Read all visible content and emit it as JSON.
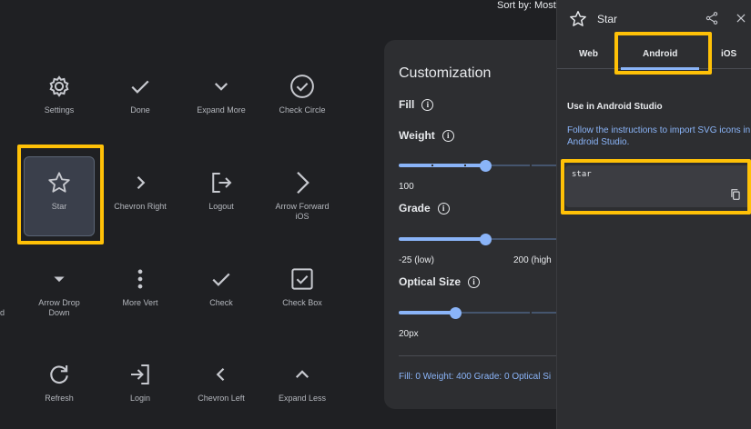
{
  "header": {
    "sort_label": "Sort by: Most"
  },
  "icons": [
    {
      "label": "Settings"
    },
    {
      "label": "Done"
    },
    {
      "label": "Expand More"
    },
    {
      "label": "Check Circle"
    },
    {
      "label": "Star"
    },
    {
      "label": "Chevron Right"
    },
    {
      "label": "Logout"
    },
    {
      "label": "Arrow Forward iOS"
    },
    {
      "label": "d"
    },
    {
      "label": "Arrow Drop Down"
    },
    {
      "label": "More Vert"
    },
    {
      "label": "Check"
    },
    {
      "label": "Check Box"
    },
    {
      "label": "Refresh"
    },
    {
      "label": "Login"
    },
    {
      "label": "Chevron Left"
    },
    {
      "label": "Expand Less"
    }
  ],
  "customization": {
    "title": "Customization",
    "fill_label": "Fill",
    "weight_label": "Weight",
    "weight_value": "100",
    "weight_level": 0.5,
    "grade_label": "Grade",
    "grade_low": "-25 (low)",
    "grade_high": "200 (high",
    "grade_level": 0.5,
    "optical_label": "Optical Size",
    "optical_value": "20px",
    "optical_level": 0.33,
    "summary": "Fill: 0 Weight: 400 Grade: 0 Optical Si"
  },
  "side_panel": {
    "title": "Star",
    "tabs": {
      "web": "Web",
      "android": "Android",
      "ios": "iOS"
    },
    "active_tab": "Android",
    "section_title": "Use in Android Studio",
    "instructions": "Follow the instructions to import SVG icons in Android Studio.",
    "code": "star"
  },
  "colors": {
    "accent": "#8ab4f8",
    "highlight": "#ffc107",
    "background": "#1f2023",
    "panel": "#2d2e31"
  }
}
